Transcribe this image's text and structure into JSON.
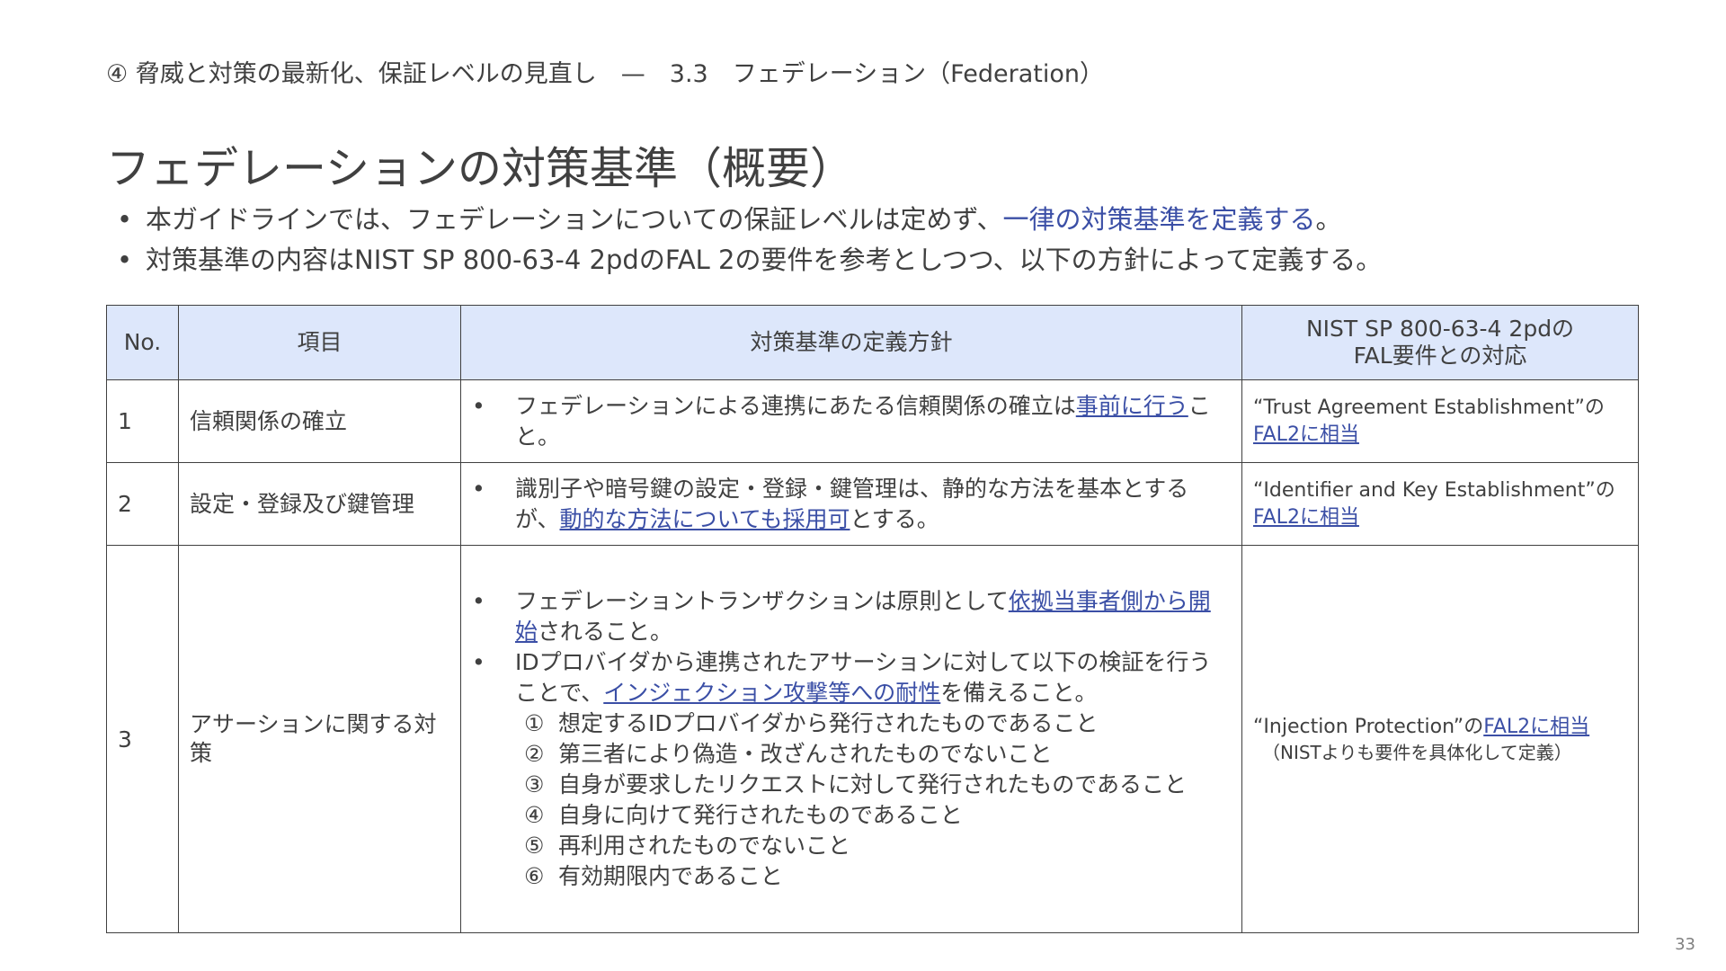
{
  "header": {
    "breadcrumb": "④ 脅威と対策の最新化、保証レベルの見直し　—　3.3　フェデレーション（Federation）"
  },
  "slide": {
    "title": "フェデレーションの対策基準（概要）",
    "bullets": [
      {
        "pre": "本ガイドラインでは、フェデレーションについての保証レベルは定めず、",
        "accent": "一律の対策基準を定義する",
        "post": "。"
      },
      {
        "text": "対策基準の内容はNIST SP 800-63-4 2pdのFAL 2の要件を参考としつつ、以下の方針によって定義する。"
      }
    ]
  },
  "table": {
    "headers": {
      "no": "No.",
      "item": "項目",
      "policy": "対策基準の定義方針",
      "nist_line1": "NIST SP 800-63-4 2pdの",
      "nist_line2": "FAL要件との対応"
    },
    "rows": [
      {
        "no": "1",
        "item": "信頼関係の確立",
        "policy": [
          {
            "pre": "フェデレーションによる連携にあたる信頼関係の確立は",
            "link": "事前に行う",
            "post": "こと。"
          }
        ],
        "nist": {
          "pre": "“Trust Agreement Establishment”の",
          "link": "FAL2に相当",
          "post": ""
        }
      },
      {
        "no": "2",
        "item": "設定・登録及び鍵管理",
        "policy": [
          {
            "pre": "識別子や暗号鍵の設定・登録・鍵管理は、静的な方法を基本とするが、",
            "link": "動的な方法についても採用可",
            "post": "とする。"
          }
        ],
        "nist": {
          "pre": "“Identifier and Key Establishment”の",
          "link": "FAL2に相当",
          "post": ""
        }
      },
      {
        "no": "3",
        "item": "アサーションに関する対策",
        "policy": [
          {
            "pre": "フェデレーショントランザクションは原則として",
            "link": "依拠当事者側から開始",
            "post": "されること。"
          },
          {
            "pre": "IDプロバイダから連携されたアサーションに対して以下の検証を行うことで、",
            "link": "インジェクション攻撃等への耐性",
            "post": "を備えること。"
          }
        ],
        "checks": [
          {
            "num": "①",
            "text": "想定するIDプロバイダから発行されたものであること"
          },
          {
            "num": "②",
            "text": "第三者により偽造・改ざんされたものでないこと"
          },
          {
            "num": "③",
            "text": "自身が要求したリクエストに対して発行されたものであること"
          },
          {
            "num": "④",
            "text": "自身に向けて発行されたものであること"
          },
          {
            "num": "⑤",
            "text": "再利用されたものでないこと"
          },
          {
            "num": "⑥",
            "text": "有効期限内であること"
          }
        ],
        "nist": {
          "pre": "“Injection Protection”の",
          "link": "FAL2に相当",
          "post": "",
          "note": "（NISTよりも要件を具体化して定義）"
        }
      }
    ]
  },
  "footer": {
    "page_number": "33"
  },
  "colors": {
    "text": "#404040",
    "accent": "#3b4fa6",
    "header_fill": "#dde7fb",
    "border": "#404040"
  }
}
